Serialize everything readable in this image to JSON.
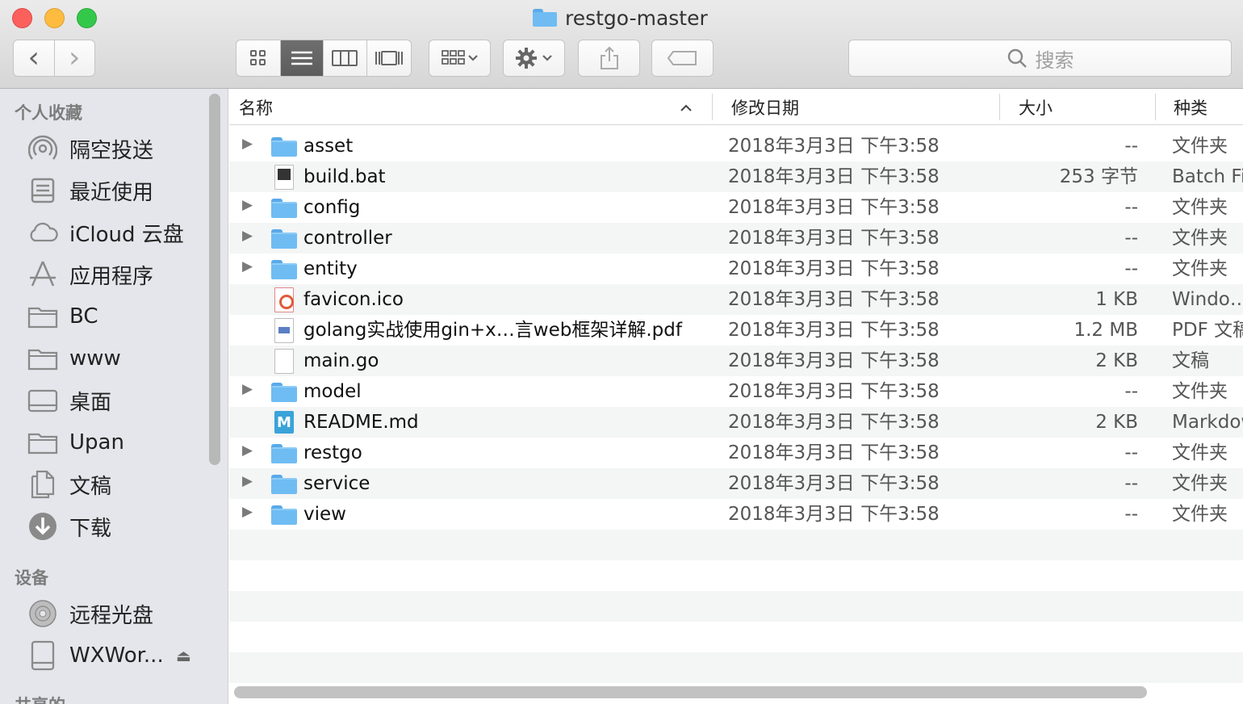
{
  "window": {
    "title": "restgo-master"
  },
  "toolbar": {
    "back": "‹",
    "forward": "›",
    "view_icons": [
      "icon-view-icon",
      "list-view-icon",
      "column-view-icon",
      "coverflow-view-icon"
    ],
    "search_placeholder": "搜索"
  },
  "sidebar": {
    "section_favorites": "个人收藏",
    "favorites": [
      {
        "label": "隔空投送",
        "icon": "airdrop-icon"
      },
      {
        "label": "最近使用",
        "icon": "recents-icon"
      },
      {
        "label": "iCloud 云盘",
        "icon": "cloud-icon"
      },
      {
        "label": "应用程序",
        "icon": "applications-icon"
      },
      {
        "label": "BC",
        "icon": "folder-icon"
      },
      {
        "label": "www",
        "icon": "folder-icon"
      },
      {
        "label": "桌面",
        "icon": "desktop-icon"
      },
      {
        "label": "Upan",
        "icon": "folder-icon"
      },
      {
        "label": "文稿",
        "icon": "documents-icon"
      },
      {
        "label": "下载",
        "icon": "downloads-icon"
      }
    ],
    "section_devices": "设备",
    "devices": [
      {
        "label": "远程光盘",
        "icon": "disc-icon"
      },
      {
        "label": "WXWor...",
        "icon": "drive-icon"
      }
    ],
    "section_shared": "共享的"
  },
  "columns": {
    "name": "名称",
    "date": "修改日期",
    "size": "大小",
    "kind": "种类"
  },
  "files": [
    {
      "name": "asset",
      "date": "2018年3月3日 下午3:58",
      "size": "--",
      "kind": "文件夹",
      "type": "folder"
    },
    {
      "name": "build.bat",
      "date": "2018年3月3日 下午3:58",
      "size": "253 字节",
      "kind": "Batch File",
      "type": "batch"
    },
    {
      "name": "config",
      "date": "2018年3月3日 下午3:58",
      "size": "--",
      "kind": "文件夹",
      "type": "folder"
    },
    {
      "name": "controller",
      "date": "2018年3月3日 下午3:58",
      "size": "--",
      "kind": "文件夹",
      "type": "folder"
    },
    {
      "name": "entity",
      "date": "2018年3月3日 下午3:58",
      "size": "--",
      "kind": "文件夹",
      "type": "folder"
    },
    {
      "name": "favicon.ico",
      "date": "2018年3月3日 下午3:58",
      "size": "1 KB",
      "kind": "Windo…",
      "type": "ico"
    },
    {
      "name": "golang实战使用gin+x…言web框架详解.pdf",
      "date": "2018年3月3日 下午3:58",
      "size": "1.2 MB",
      "kind": "PDF 文稿",
      "type": "pdf"
    },
    {
      "name": "main.go",
      "date": "2018年3月3日 下午3:58",
      "size": "2 KB",
      "kind": "文稿",
      "type": "doc"
    },
    {
      "name": "model",
      "date": "2018年3月3日 下午3:58",
      "size": "--",
      "kind": "文件夹",
      "type": "folder"
    },
    {
      "name": "README.md",
      "date": "2018年3月3日 下午3:58",
      "size": "2 KB",
      "kind": "Markdown",
      "type": "md"
    },
    {
      "name": "restgo",
      "date": "2018年3月3日 下午3:58",
      "size": "--",
      "kind": "文件夹",
      "type": "folder"
    },
    {
      "name": "service",
      "date": "2018年3月3日 下午3:58",
      "size": "--",
      "kind": "文件夹",
      "type": "folder"
    },
    {
      "name": "view",
      "date": "2018年3月3日 下午3:58",
      "size": "--",
      "kind": "文件夹",
      "type": "folder"
    }
  ]
}
